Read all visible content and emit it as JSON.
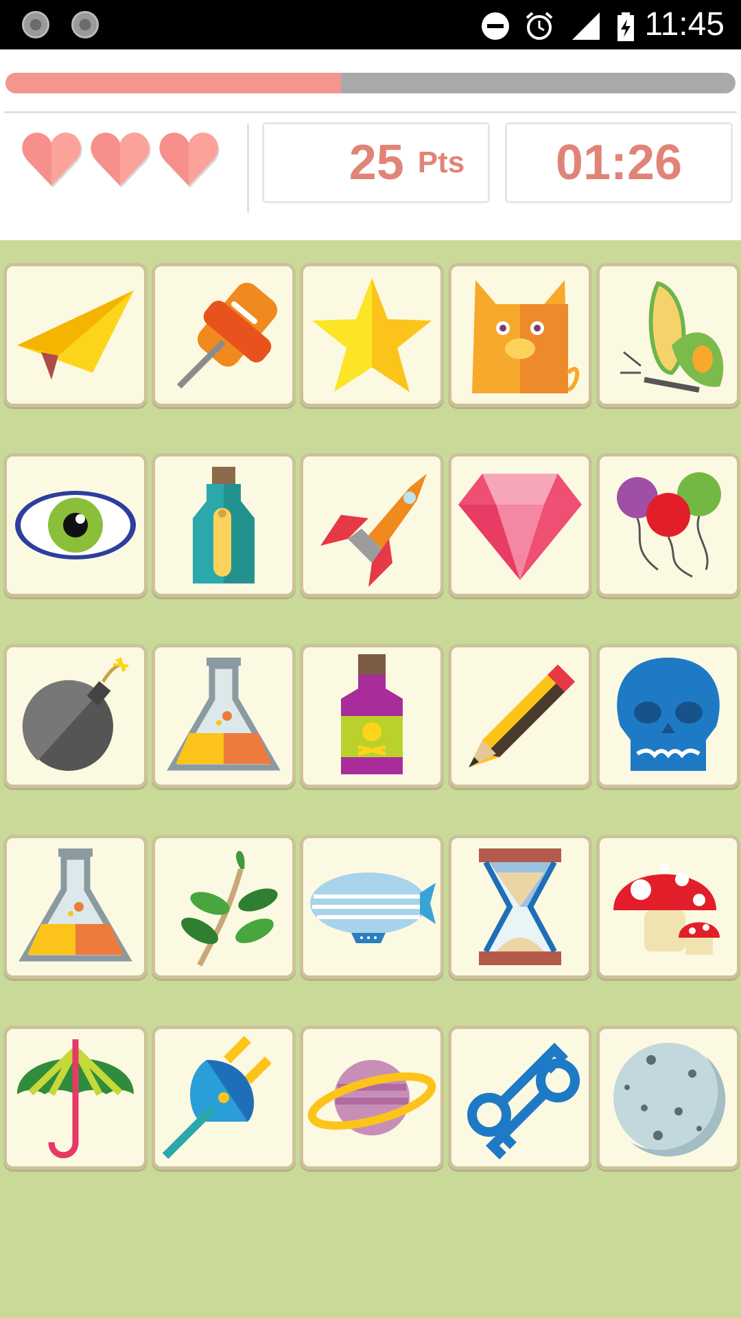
{
  "status_bar": {
    "time": "11:45"
  },
  "game": {
    "progress": 0.46,
    "lives": 3,
    "score_value": "25",
    "score_unit": "Pts",
    "timer": "01:26"
  },
  "board": {
    "tiles": [
      [
        "paper-plane-icon",
        "push-pin-icon",
        "star-icon",
        "cat-icon",
        "butterfly-icon"
      ],
      [
        "eye-icon",
        "message-bottle-icon",
        "rocket-icon",
        "diamond-icon",
        "balloons-icon"
      ],
      [
        "bomb-icon",
        "flask-icon",
        "poison-bottle-icon",
        "pencil-icon",
        "skull-icon"
      ],
      [
        "flask-icon",
        "plant-branch-icon",
        "zeppelin-icon",
        "hourglass-icon",
        "mushroom-icon"
      ],
      [
        "umbrella-icon",
        "plug-icon",
        "planet-icon",
        "keys-icon",
        "moon-icon"
      ]
    ]
  },
  "colors": {
    "board_bg": "#c9da98",
    "tile_bg": "#fcf9e2",
    "accent": "#e08478",
    "progress_fill": "#f3968e"
  }
}
